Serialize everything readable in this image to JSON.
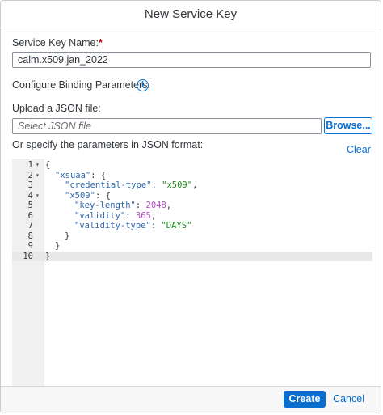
{
  "dialog": {
    "title": "New Service Key"
  },
  "form": {
    "service_key_label": "Service Key Name:",
    "required_marker": "*",
    "service_key_value": "calm.x509.jan_2022",
    "binding_label": "Configure Binding Parameters:",
    "upload_label": "Upload a JSON file:",
    "file_placeholder": "Select JSON file",
    "browse_label": "Browse...",
    "json_label": "Or specify the parameters in JSON format:",
    "clear_label": "Clear"
  },
  "editor": {
    "lines": [
      {
        "n": "1",
        "fold": true,
        "indent": 0,
        "tokens": [
          [
            "p",
            "{"
          ]
        ]
      },
      {
        "n": "2",
        "fold": true,
        "indent": 1,
        "tokens": [
          [
            "k",
            "\"xsuaa\""
          ],
          [
            "p",
            ": {"
          ]
        ]
      },
      {
        "n": "3",
        "fold": false,
        "indent": 2,
        "tokens": [
          [
            "k",
            "\"credential-type\""
          ],
          [
            "p",
            ": "
          ],
          [
            "s",
            "\"x509\""
          ],
          [
            "p",
            ","
          ]
        ]
      },
      {
        "n": "4",
        "fold": true,
        "indent": 2,
        "tokens": [
          [
            "k",
            "\"x509\""
          ],
          [
            "p",
            ": {"
          ]
        ]
      },
      {
        "n": "5",
        "fold": false,
        "indent": 3,
        "tokens": [
          [
            "k",
            "\"key-length\""
          ],
          [
            "p",
            ": "
          ],
          [
            "n",
            "2048"
          ],
          [
            "p",
            ","
          ]
        ]
      },
      {
        "n": "6",
        "fold": false,
        "indent": 3,
        "tokens": [
          [
            "k",
            "\"validity\""
          ],
          [
            "p",
            ": "
          ],
          [
            "n",
            "365"
          ],
          [
            "p",
            ","
          ]
        ]
      },
      {
        "n": "7",
        "fold": false,
        "indent": 3,
        "tokens": [
          [
            "k",
            "\"validity-type\""
          ],
          [
            "p",
            ": "
          ],
          [
            "s",
            "\"DAYS\""
          ]
        ]
      },
      {
        "n": "8",
        "fold": false,
        "indent": 2,
        "tokens": [
          [
            "p",
            "}"
          ]
        ]
      },
      {
        "n": "9",
        "fold": false,
        "indent": 1,
        "tokens": [
          [
            "p",
            "}"
          ]
        ]
      },
      {
        "n": "10",
        "fold": false,
        "indent": 0,
        "tokens": [
          [
            "p",
            "}"
          ]
        ],
        "active": true
      }
    ]
  },
  "footer": {
    "create_label": "Create",
    "cancel_label": "Cancel"
  },
  "colors": {
    "accent": "#0a6ed1",
    "required": "#bb0000"
  }
}
